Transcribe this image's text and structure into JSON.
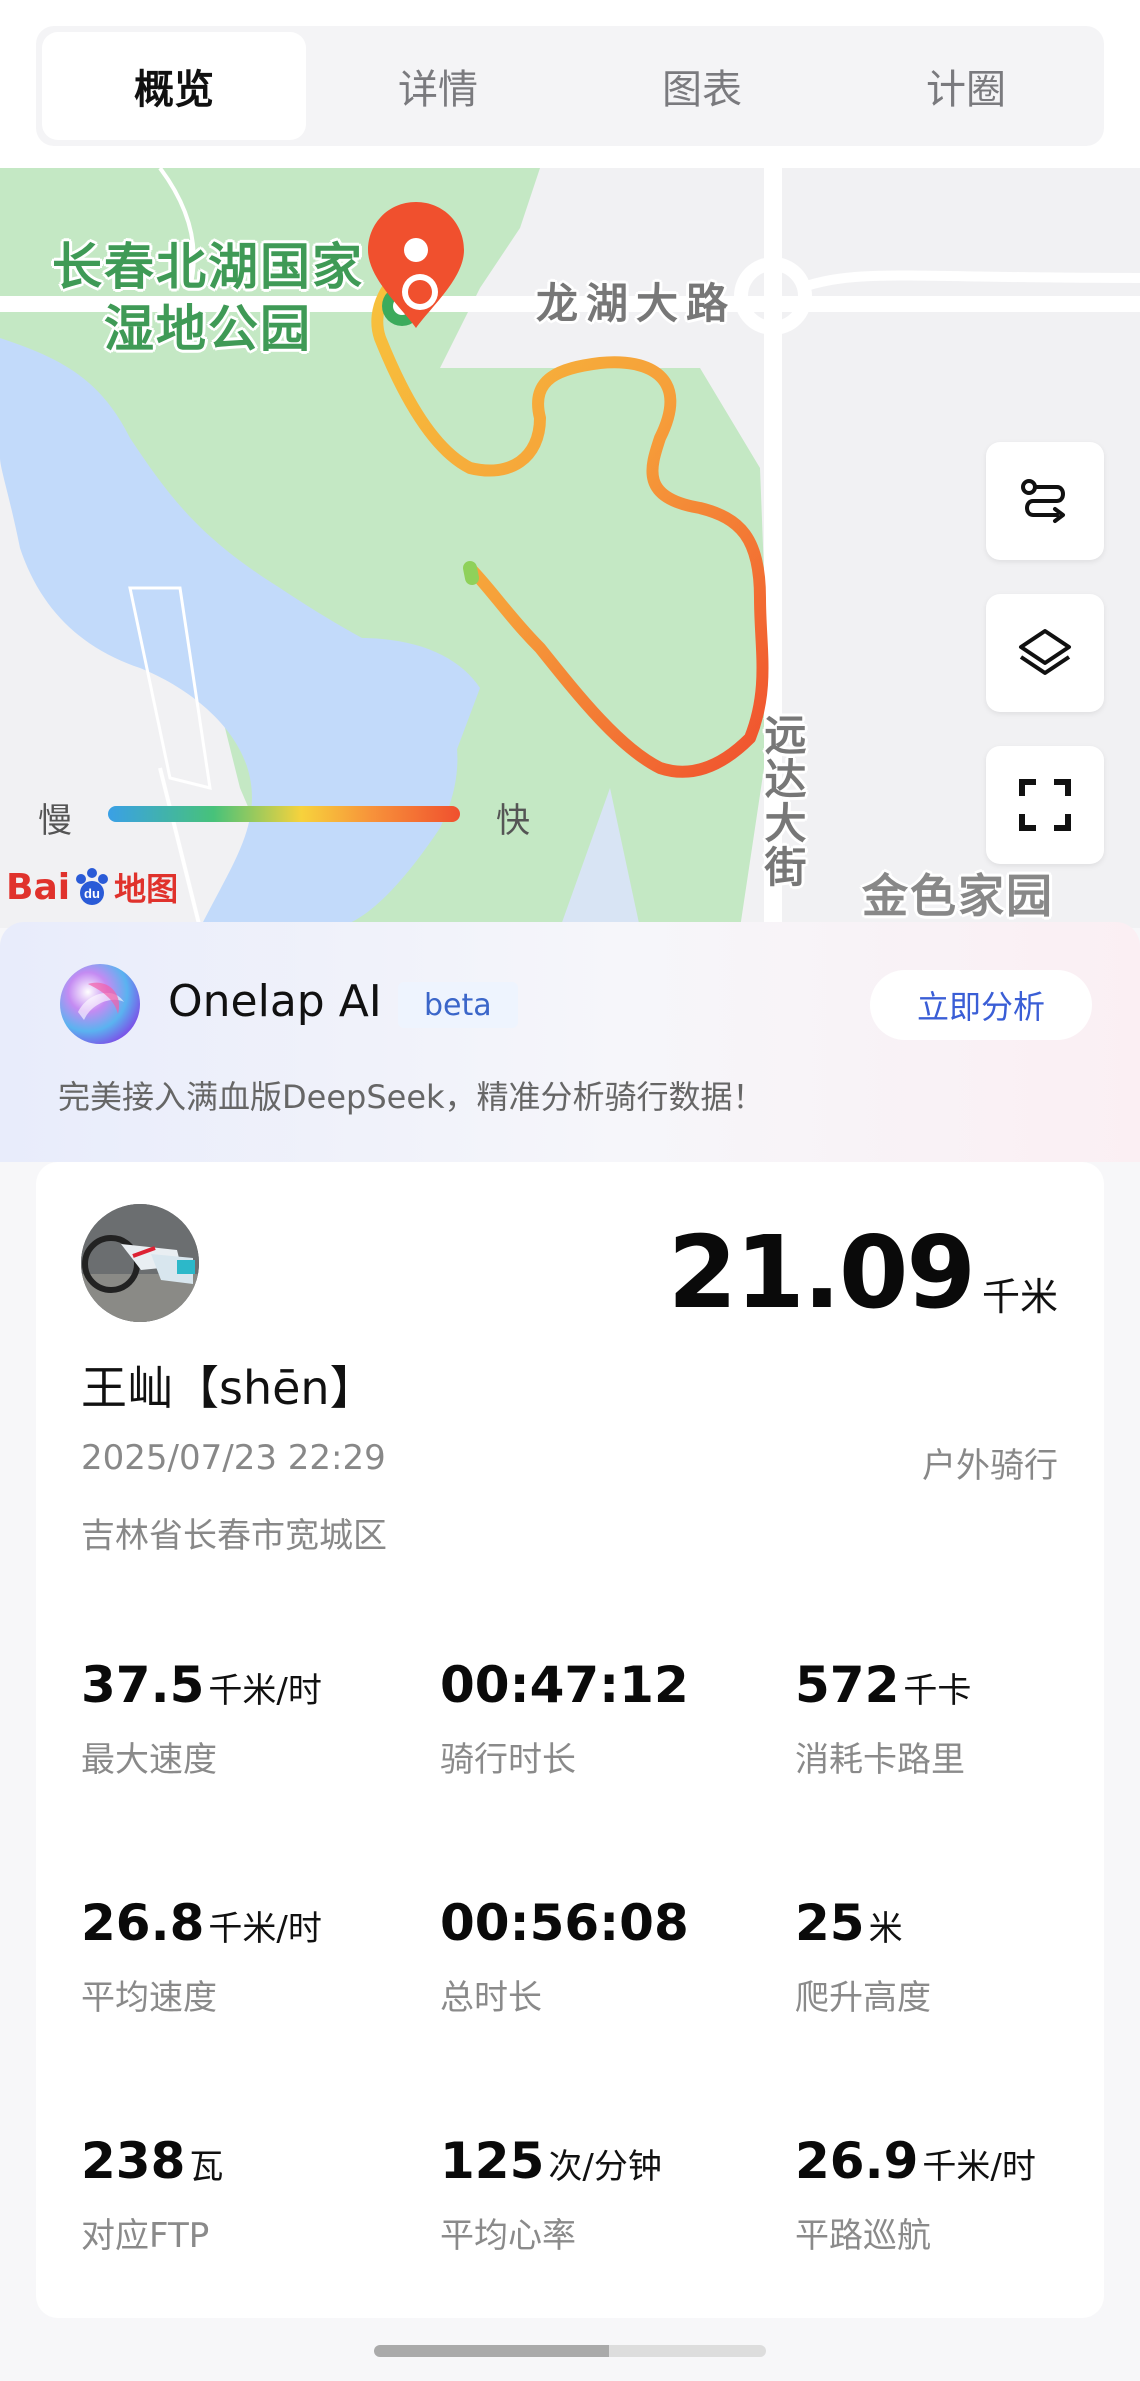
{
  "tabs": [
    {
      "label": "概览",
      "active": true
    },
    {
      "label": "详情",
      "active": false
    },
    {
      "label": "图表",
      "active": false
    },
    {
      "label": "计圈",
      "active": false
    }
  ],
  "map": {
    "park_label_line1": "长春北湖国家",
    "park_label_line2": "湿地公园",
    "road_horizontal": "龙湖大路",
    "road_vertical": "远达大街",
    "estate_label": "金色家园",
    "legend_slow": "慢",
    "legend_fast": "快",
    "provider_logo_text": "Bai",
    "provider_logo_du": "du",
    "provider_logo_map": "地图",
    "buttons": [
      "route-icon",
      "layers-icon",
      "fullscreen-icon"
    ]
  },
  "ai": {
    "title": "Onelap AI",
    "badge": "beta",
    "analyze_label": "立即分析",
    "subtitle": "完美接入满血版DeepSeek，精准分析骑行数据！"
  },
  "ride": {
    "distance_value": "21.09",
    "distance_unit": "千米",
    "user_name": "王屾【shēn】",
    "datetime": "2025/07/23 22:29",
    "ride_type": "户外骑行",
    "location": "吉林省长春市宽城区"
  },
  "stats": [
    {
      "value": "37.5",
      "unit": "千米/时",
      "label": "最大速度"
    },
    {
      "value": "00:47:12",
      "unit": "",
      "label": "骑行时长"
    },
    {
      "value": "572",
      "unit": "千卡",
      "label": "消耗卡路里"
    },
    {
      "value": "26.8",
      "unit": "千米/时",
      "label": "平均速度"
    },
    {
      "value": "00:56:08",
      "unit": "",
      "label": "总时长"
    },
    {
      "value": "25",
      "unit": "米",
      "label": "爬升高度"
    },
    {
      "value": "238",
      "unit": "瓦",
      "label": "对应FTP"
    },
    {
      "value": "125",
      "unit": "次/分钟",
      "label": "平均心率"
    },
    {
      "value": "26.9",
      "unit": "千米/时",
      "label": "平路巡航"
    }
  ],
  "colors": {
    "accent_blue": "#3a5ed6",
    "route_start": "#47c27a",
    "route_end": "#f0502e"
  }
}
